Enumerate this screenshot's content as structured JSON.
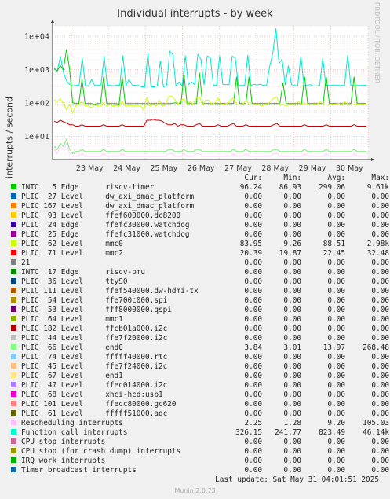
{
  "header": {
    "title": "Individual interrupts - by week",
    "side_label": "RRDTOOL / TOBI OETIKER"
  },
  "chart_data": {
    "type": "line",
    "title": "Individual interrupts - by week",
    "ylabel": "interrupts / second",
    "yscale": "log",
    "ylim": [
      2,
      20000
    ],
    "y_ticks": [
      {
        "value": 10,
        "label": "1e+01"
      },
      {
        "value": 100,
        "label": "1e+02"
      },
      {
        "value": 1000,
        "label": "1e+03"
      },
      {
        "value": 10000,
        "label": "1e+04"
      }
    ],
    "x_ticks": [
      "23 May",
      "24 May",
      "25 May",
      "26 May",
      "27 May",
      "28 May",
      "29 May",
      "30 May"
    ],
    "grid": true,
    "series": [
      {
        "name": "Function call interrupts",
        "color": "#00e8d0",
        "values": [
          1000,
          900,
          2500,
          800,
          450,
          350,
          320,
          330,
          340,
          2200,
          330,
          320,
          500,
          330,
          330,
          340,
          2500,
          330,
          330,
          320,
          340,
          330,
          2600,
          330,
          500,
          340,
          330,
          330,
          300,
          300,
          3000,
          300,
          300,
          320,
          1800,
          300,
          320,
          3500,
          2800,
          320,
          420,
          320,
          2600,
          350,
          420,
          360,
          2800,
          2000,
          340,
          2500,
          2300,
          330,
          340,
          2600,
          360,
          350,
          350,
          2500,
          2200,
          330,
          330,
          330,
          2700,
          330,
          360,
          340,
          360,
          330,
          330,
          1200,
          3000,
          17000,
          1500,
          2000,
          340,
          1300,
          350,
          330,
          320,
          2600,
          330,
          330,
          350,
          320,
          320,
          330,
          2200,
          330,
          330,
          340,
          340,
          330,
          330,
          330,
          2700,
          330,
          320,
          330,
          330,
          330,
          340
        ]
      },
      {
        "name": "riscv-timer",
        "color": "#00cc00",
        "values": [
          1100,
          900,
          1300,
          1000,
          4000,
          1000,
          100,
          95,
          95,
          500,
          95,
          95,
          95,
          90,
          95,
          95,
          600,
          95,
          95,
          95,
          95,
          90,
          600,
          95,
          95,
          95,
          95,
          95,
          95,
          95,
          95,
          95,
          95,
          95,
          95,
          95,
          95,
          95,
          95,
          100,
          95,
          95,
          700,
          95,
          95,
          95,
          95,
          800,
          95,
          95,
          95,
          95,
          95,
          95,
          95,
          95,
          95,
          95,
          95,
          600,
          95,
          95,
          95,
          600,
          95,
          95,
          95,
          95,
          95,
          95,
          95,
          95,
          95,
          95,
          400,
          95,
          95,
          95,
          95,
          95,
          95,
          600,
          95,
          95,
          95,
          95,
          95,
          95,
          600,
          95,
          95,
          95,
          95,
          95,
          95,
          95,
          95,
          600,
          95,
          95,
          95,
          95
        ]
      },
      {
        "name": "mmc0",
        "color": "#ccff00",
        "values": [
          120,
          110,
          130,
          100,
          60,
          90,
          50,
          80,
          90,
          110,
          80,
          85,
          70,
          90,
          80,
          80,
          100,
          80,
          90,
          80,
          85,
          80,
          110,
          80,
          80,
          85,
          80,
          80,
          80,
          60,
          140,
          80,
          90,
          80,
          120,
          80,
          90,
          150,
          160,
          130,
          90,
          120,
          130,
          90,
          110,
          90,
          140,
          150,
          90,
          120,
          120,
          90,
          100,
          140,
          90,
          90,
          95,
          120,
          140,
          90,
          85,
          90,
          120,
          90,
          85,
          90,
          90,
          80,
          90,
          90,
          110,
          140,
          150,
          85,
          90,
          80,
          90,
          90,
          85,
          110,
          90,
          95,
          90,
          85,
          90,
          90,
          110,
          90,
          85,
          90,
          90,
          90,
          95,
          85,
          110,
          90,
          85,
          90,
          90,
          90,
          90,
          90
        ]
      },
      {
        "name": "mmc2",
        "color": "#cc0000",
        "values": [
          28,
          26,
          30,
          27,
          25,
          22,
          22,
          20,
          20,
          22,
          20,
          20,
          20,
          20,
          20,
          20,
          22,
          20,
          20,
          20,
          20,
          20,
          22,
          20,
          20,
          20,
          20,
          20,
          20,
          20,
          30,
          30,
          32,
          30,
          30,
          28,
          24,
          22,
          22,
          24,
          20,
          22,
          22,
          20,
          20,
          20,
          22,
          24,
          20,
          20,
          20,
          20,
          20,
          22,
          20,
          20,
          20,
          22,
          24,
          20,
          20,
          20,
          22,
          20,
          20,
          20,
          20,
          20,
          20,
          20,
          20,
          22,
          24,
          20,
          20,
          20,
          20,
          20,
          20,
          20,
          20,
          22,
          20,
          20,
          20,
          20,
          20,
          20,
          22,
          20,
          20,
          20,
          20,
          20,
          20,
          20,
          20,
          22,
          20,
          20,
          20,
          20
        ]
      },
      {
        "name": "end0",
        "color": "#77ee77",
        "values": [
          5,
          4,
          6,
          5,
          8,
          4,
          3,
          3.5,
          3.5,
          4,
          3.5,
          3.5,
          3.5,
          3.5,
          3.5,
          3.5,
          4,
          3.5,
          3.5,
          3.5,
          3.5,
          3.5,
          4,
          3.5,
          3.5,
          3.5,
          3.5,
          3.5,
          3.5,
          3.5,
          3.5,
          3.5,
          3.5,
          3.5,
          3.5,
          3.5,
          3.5,
          4,
          4,
          3.5,
          3.5,
          3.5,
          4,
          3.5,
          3.5,
          3.5,
          4,
          4,
          3.5,
          3.5,
          3.5,
          3.5,
          3.5,
          3.5,
          3.5,
          3.5,
          3.5,
          3.5,
          4,
          3.5,
          3.5,
          3.5,
          4,
          3.5,
          3.5,
          3.5,
          3.5,
          3.5,
          3.5,
          3.5,
          3.5,
          4,
          4,
          3.5,
          3.5,
          3.5,
          3.5,
          3.5,
          3.5,
          3.5,
          3.5,
          4,
          3.5,
          3.5,
          3.5,
          3.5,
          3.5,
          3.5,
          4,
          3.5,
          3.5,
          3.5,
          3.5,
          3.5,
          3.5,
          3.5,
          3.5,
          4,
          3.5,
          3.5,
          3.5,
          3.5
        ]
      },
      {
        "name": "Rescheduling interrupts",
        "color": "#ffccff",
        "values": [
          4,
          3,
          5,
          4,
          6,
          3,
          2.5,
          2.5,
          2.5,
          3,
          2.5,
          2.5,
          2.5,
          2.5,
          2.5,
          2.5,
          3,
          2.5,
          2.5,
          2.5,
          2.5,
          2.5,
          3,
          2.5,
          2.5,
          2.5,
          2.5,
          2.5,
          2.5,
          2.5,
          2.5,
          2.5,
          2.5,
          2.5,
          2.5,
          2.5,
          2.5,
          3,
          3,
          2.5,
          2.5,
          2.5,
          3,
          2.5,
          2.5,
          2.5,
          3,
          3,
          2.5,
          2.5,
          2.5,
          2.5,
          2.5,
          2.5,
          2.5,
          2.5,
          2.5,
          2.5,
          3,
          2.5,
          2.5,
          2.5,
          3,
          2.5,
          2.5,
          2.5,
          2.5,
          2.5,
          2.5,
          2.5,
          2.5,
          3,
          3,
          2.5,
          2.5,
          2.5,
          2.5,
          2.5,
          2.5,
          2.5,
          2.5,
          3,
          2.5,
          2.5,
          2.5,
          2.5,
          2.5,
          2.5,
          3,
          2.5,
          2.5,
          2.5,
          2.5,
          2.5,
          2.5,
          2.5,
          2.5,
          3,
          2.5,
          2.5,
          2.5,
          2.5
        ]
      }
    ]
  },
  "legend": {
    "columns": [
      "",
      "Cur:",
      "Min:",
      "Avg:",
      "Max:"
    ],
    "rows": [
      {
        "color": "#00cc00",
        "label": "INTC   5 Edge      riscv-timer",
        "cur": "96.24",
        "min": "86.93",
        "avg": "299.06",
        "max": "9.61k"
      },
      {
        "color": "#0066b3",
        "label": "PLIC  27 Level     dw_axi_dmac_platform",
        "cur": "0.00",
        "min": "0.00",
        "avg": "0.00",
        "max": "0.00"
      },
      {
        "color": "#ff8000",
        "label": "PLIC 167 Level     dw_axi_dmac_platform",
        "cur": "0.00",
        "min": "0.00",
        "avg": "0.00",
        "max": "0.00"
      },
      {
        "color": "#ffcc00",
        "label": "PLIC  93 Level     ffef600000.dc8200",
        "cur": "0.00",
        "min": "0.00",
        "avg": "0.00",
        "max": "0.00"
      },
      {
        "color": "#330099",
        "label": "PLIC  24 Edge      ffefc30000.watchdog",
        "cur": "0.00",
        "min": "0.00",
        "avg": "0.00",
        "max": "0.00"
      },
      {
        "color": "#990099",
        "label": "PLIC  25 Edge      ffefc31000.watchdog",
        "cur": "0.00",
        "min": "0.00",
        "avg": "0.00",
        "max": "0.00"
      },
      {
        "color": "#ccff00",
        "label": "PLIC  62 Level     mmc0",
        "cur": "83.95",
        "min": "9.26",
        "avg": "88.51",
        "max": "2.98k"
      },
      {
        "color": "#ff0000",
        "label": "PLIC  71 Level     mmc2",
        "cur": "20.39",
        "min": "19.87",
        "avg": "22.45",
        "max": "32.48"
      },
      {
        "color": "#808080",
        "label": "21",
        "cur": "0.00",
        "min": "0.00",
        "avg": "0.00",
        "max": "0.00"
      },
      {
        "color": "#008f00",
        "label": "INTC  17 Edge      riscv-pmu",
        "cur": "0.00",
        "min": "0.00",
        "avg": "0.00",
        "max": "0.00"
      },
      {
        "color": "#00487d",
        "label": "PLIC  36 Level     ttyS0",
        "cur": "0.00",
        "min": "0.00",
        "avg": "0.00",
        "max": "0.00"
      },
      {
        "color": "#b35a00",
        "label": "PLIC 111 Level     ffef540000.dw-hdmi-tx",
        "cur": "0.00",
        "min": "0.00",
        "avg": "0.00",
        "max": "0.00"
      },
      {
        "color": "#b38f00",
        "label": "PLIC  54 Level     ffe700c000.spi",
        "cur": "0.00",
        "min": "0.00",
        "avg": "0.00",
        "max": "0.00"
      },
      {
        "color": "#6b006b",
        "label": "PLIC  53 Level     fff8000000.qspi",
        "cur": "0.00",
        "min": "0.00",
        "avg": "0.00",
        "max": "0.00"
      },
      {
        "color": "#8fb300",
        "label": "PLIC  64 Level     mmc1",
        "cur": "0.00",
        "min": "0.00",
        "avg": "0.00",
        "max": "0.00"
      },
      {
        "color": "#b30000",
        "label": "PLIC 182 Level     ffcb01a000.i2c",
        "cur": "0.00",
        "min": "0.00",
        "avg": "0.00",
        "max": "0.00"
      },
      {
        "color": "#bebebe",
        "label": "PLIC  44 Level     ffe7f20000.i2c",
        "cur": "0.00",
        "min": "0.00",
        "avg": "0.00",
        "max": "0.00"
      },
      {
        "color": "#80ff80",
        "label": "PLIC  66 Level     end0",
        "cur": "3.84",
        "min": "3.01",
        "avg": "13.97",
        "max": "268.48"
      },
      {
        "color": "#80c9ff",
        "label": "PLIC  74 Level     fffff40000.rtc",
        "cur": "0.00",
        "min": "0.00",
        "avg": "0.00",
        "max": "0.00"
      },
      {
        "color": "#ffc080",
        "label": "PLIC  45 Level     ffe7f24000.i2c",
        "cur": "0.00",
        "min": "0.00",
        "avg": "0.00",
        "max": "0.00"
      },
      {
        "color": "#ffe680",
        "label": "PLIC  67 Level     end1",
        "cur": "0.00",
        "min": "0.00",
        "avg": "0.00",
        "max": "0.00"
      },
      {
        "color": "#aa80ff",
        "label": "PLIC  47 Level     ffec014000.i2c",
        "cur": "0.00",
        "min": "0.00",
        "avg": "0.00",
        "max": "0.00"
      },
      {
        "color": "#ee00cc",
        "label": "PLIC  68 Level     xhci-hcd:usb1",
        "cur": "0.00",
        "min": "0.00",
        "avg": "0.00",
        "max": "0.00"
      },
      {
        "color": "#ff8080",
        "label": "PLIC 101 Level     ffecc80000.gc620",
        "cur": "0.00",
        "min": "0.00",
        "avg": "0.00",
        "max": "0.00"
      },
      {
        "color": "#666600",
        "label": "PLIC  61 Level     fffff51000.adc",
        "cur": "0.00",
        "min": "0.00",
        "avg": "0.00",
        "max": "0.00"
      },
      {
        "color": "#ffbfff",
        "label": "Rescheduling interrupts",
        "cur": "2.25",
        "min": "1.28",
        "avg": "9.20",
        "max": "105.03"
      },
      {
        "color": "#00ffcc",
        "label": "Function call interrupts",
        "cur": "326.15",
        "min": "241.77",
        "avg": "823.49",
        "max": "46.14k"
      },
      {
        "color": "#cc6699",
        "label": "CPU stop interrupts",
        "cur": "0.00",
        "min": "0.00",
        "avg": "0.00",
        "max": "0.00"
      },
      {
        "color": "#999900",
        "label": "CPU stop (for crash dump) interrupts",
        "cur": "0.00",
        "min": "0.00",
        "avg": "0.00",
        "max": "0.00"
      },
      {
        "color": "#00b300",
        "label": "IRQ work interrupts",
        "cur": "0.00",
        "min": "0.00",
        "avg": "0.00",
        "max": "0.00"
      },
      {
        "color": "#0f6dab",
        "label": "Timer broadcast interrupts",
        "cur": "0.00",
        "min": "0.00",
        "avg": "0.00",
        "max": "0.00"
      }
    ]
  },
  "footer": {
    "last_update": "Last update: Sat May 31 04:01:51 2025",
    "version": "Munin 2.0.73"
  }
}
